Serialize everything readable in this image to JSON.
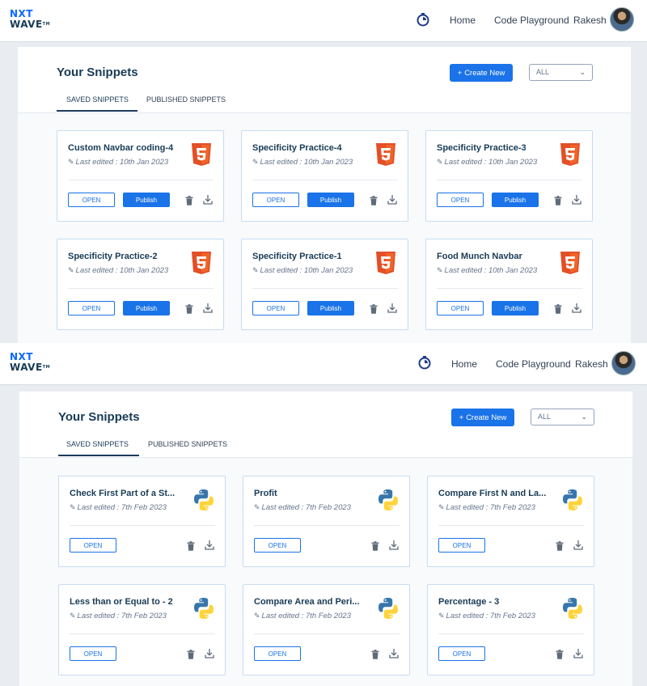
{
  "nav": {
    "logo_line1": "NXT",
    "logo_line2": "WAVE",
    "logo_tm": "TM",
    "links": [
      "Home",
      "Code Playground"
    ],
    "user": "Rakesh"
  },
  "header": {
    "title": "Your Snippets",
    "create_label": "Create New",
    "filter_value": "ALL",
    "tabs": [
      "SAVED SNIPPETS",
      "PUBLISHED SNIPPETS"
    ]
  },
  "labels": {
    "open": "OPEN",
    "publish": "Publish"
  },
  "shot1": {
    "cards": [
      {
        "title": "Custom Navbar coding-4",
        "edited": "Last edited : 10th Jan 2023",
        "lang": "html5-icon"
      },
      {
        "title": "Specificity Practice-4",
        "edited": "Last edited : 10th Jan 2023",
        "lang": "html5-icon"
      },
      {
        "title": "Specificity Practice-3",
        "edited": "Last edited : 10th Jan 2023",
        "lang": "html5-icon"
      },
      {
        "title": "Specificity Practice-2",
        "edited": "Last edited : 10th Jan 2023",
        "lang": "html5-icon"
      },
      {
        "title": "Specificity Practice-1",
        "edited": "Last edited : 10th Jan 2023",
        "lang": "html5-icon"
      },
      {
        "title": "Food Munch Navbar",
        "edited": "Last edited : 10th Jan 2023",
        "lang": "html5-icon"
      }
    ]
  },
  "shot2": {
    "cards": [
      {
        "title": "Check First Part of a St...",
        "edited": "Last edited : 7th Feb 2023",
        "lang": "python-icon"
      },
      {
        "title": "Profit",
        "edited": "Last edited : 7th Feb 2023",
        "lang": "python-icon"
      },
      {
        "title": "Compare First N and La...",
        "edited": "Last edited : 7th Feb 2023",
        "lang": "python-icon"
      },
      {
        "title": "Less than or Equal to - 2",
        "edited": "Last edited : 7th Feb 2023",
        "lang": "python-icon"
      },
      {
        "title": "Compare Area and Peri...",
        "edited": "Last edited : 7th Feb 2023",
        "lang": "python-icon"
      },
      {
        "title": "Percentage - 3",
        "edited": "Last edited : 7th Feb 2023",
        "lang": "python-icon"
      }
    ]
  },
  "colors": {
    "primary": "#1a73e8",
    "heading": "#183b56",
    "html5": "#e34f26",
    "python_blue": "#3776ab",
    "python_yellow": "#ffd43b"
  }
}
